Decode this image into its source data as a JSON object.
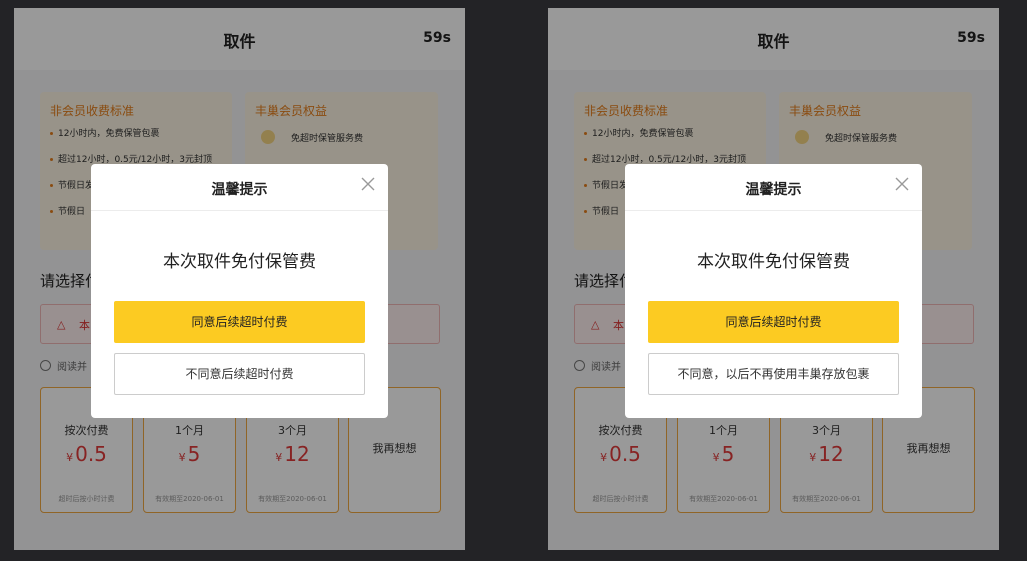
{
  "panels": [
    {
      "header": {
        "title": "取件",
        "timer": "59s"
      },
      "card_left": {
        "title": "非会员收费标准",
        "items": [
          "12小时内，免费保管包裹",
          "超过12小时，0.5元/12小时，3元封顶",
          "节假日发布为",
          "节假日"
        ]
      },
      "card_right": {
        "title": "丰巢会员权益",
        "benefit": "免超时保管服务费"
      },
      "choose_label": "请选择付",
      "notice_text": "本",
      "agree_text": "阅读并",
      "options": [
        {
          "name": "按次付费",
          "yen": "¥",
          "price": "0.5",
          "note": "超时后按小时计费"
        },
        {
          "name": "1个月",
          "yen": "¥",
          "price": "5",
          "note": "有效期至2020-06-01"
        },
        {
          "name": "3个月",
          "yen": "¥",
          "price": "12",
          "note": "有效期至2020-06-01"
        },
        {
          "name": "我再想想"
        }
      ],
      "dialog": {
        "title": "温馨提示",
        "message": "本次取件免付保管费",
        "primary_button": "同意后续超时付费",
        "secondary_button": "不同意后续超时付费"
      }
    },
    {
      "header": {
        "title": "取件",
        "timer": "59s"
      },
      "card_left": {
        "title": "非会员收费标准",
        "items": [
          "12小时内，免费保管包裹",
          "超过12小时，0.5元/12小时，3元封顶",
          "节假日发布为",
          "节假日"
        ]
      },
      "card_right": {
        "title": "丰巢会员权益",
        "benefit": "免超时保管服务费"
      },
      "choose_label": "请选择付",
      "notice_text": "本",
      "agree_text": "阅读并",
      "options": [
        {
          "name": "按次付费",
          "yen": "¥",
          "price": "0.5",
          "note": "超时后按小时计费"
        },
        {
          "name": "1个月",
          "yen": "¥",
          "price": "5",
          "note": "有效期至2020-06-01"
        },
        {
          "name": "3个月",
          "yen": "¥",
          "price": "12",
          "note": "有效期至2020-06-01"
        },
        {
          "name": "我再想想"
        }
      ],
      "dialog": {
        "title": "温馨提示",
        "message": "本次取件免付保管费",
        "primary_button": "同意后续超时付费",
        "secondary_button": "不同意，以后不再使用丰巢存放包裹"
      }
    }
  ],
  "icons": {
    "close": "close-icon",
    "bell": "bell-icon",
    "benefit": "coin-icon",
    "radio": "radio-icon"
  },
  "colors": {
    "accent_yellow": "#fccb22",
    "price_red": "#e23b3b",
    "orange": "#e67e1c"
  }
}
